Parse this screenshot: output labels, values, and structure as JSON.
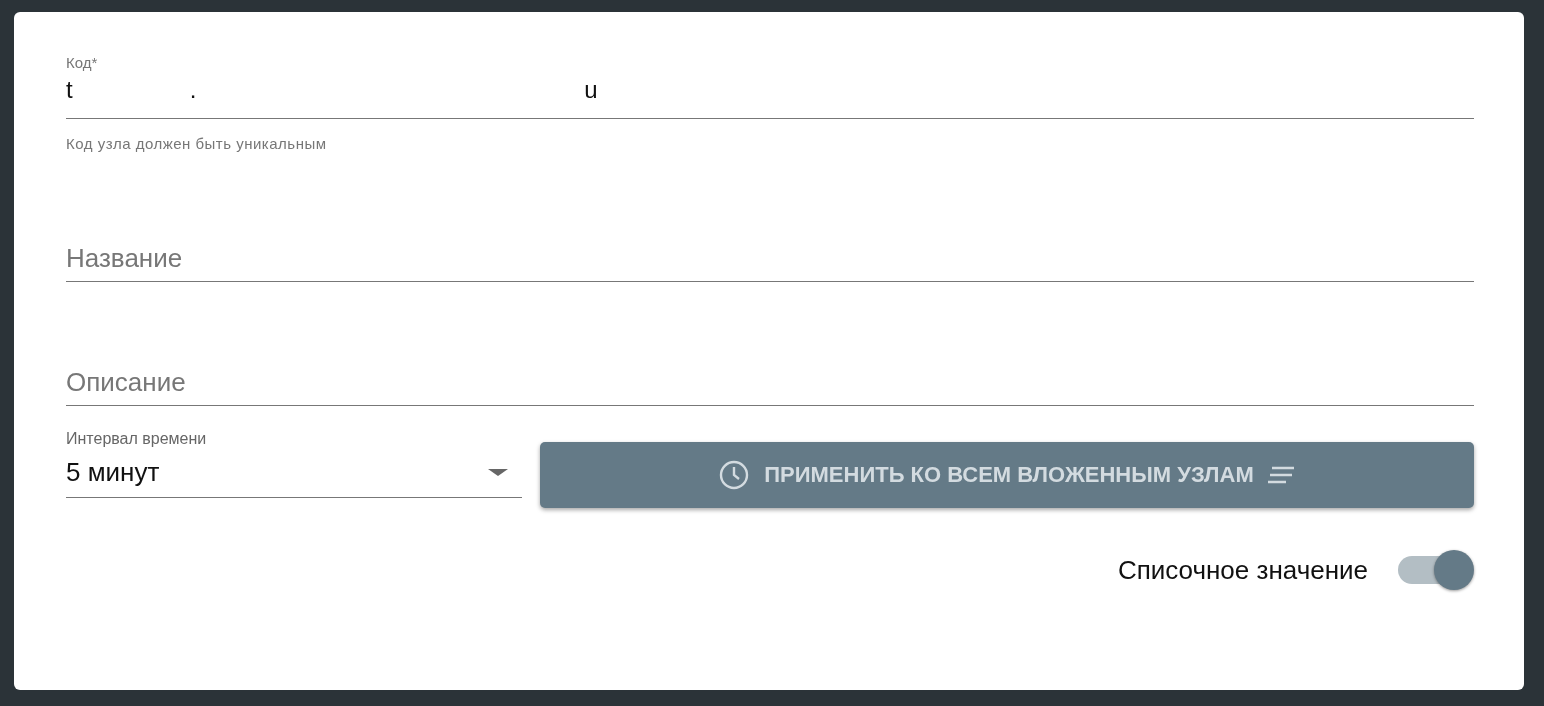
{
  "code_field": {
    "label": "Код*",
    "value_parts": [
      "t",
      ".",
      "u"
    ],
    "hint": "Код узла должен быть уникальным"
  },
  "name_field": {
    "placeholder": "Название"
  },
  "description_field": {
    "placeholder": "Описание"
  },
  "interval_select": {
    "label": "Интервал времени",
    "value": "5 минут"
  },
  "apply_button": {
    "label": "ПРИМЕНИТЬ КО ВСЕМ ВЛОЖЕННЫМ УЗЛАМ",
    "disabled": true
  },
  "list_toggle": {
    "label": "Списочное значение",
    "on": true
  }
}
